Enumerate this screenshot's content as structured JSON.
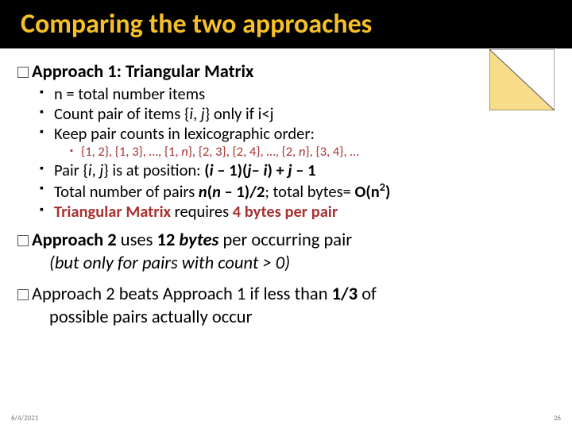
{
  "title": "Comparing the two approaches",
  "approach1": {
    "heading": "Approach 1: Triangular Matrix",
    "b1": "n = total number items",
    "b2_a": "Count pair of items {",
    "b2_b": "i",
    "b2_c": ", ",
    "b2_d": "j",
    "b2_e": "} only if i<j",
    "b3": "Keep pair counts in lexicographic order:",
    "b3sub_a": "{1, 2}, {1, 3}, …, {1, ",
    "b3sub_b": "n",
    "b3sub_c": "}, {2, 3}, {2, 4}, …, {2, ",
    "b3sub_d": "n",
    "b3sub_e": "}, {3, 4}, …",
    "b4_a": "Pair {",
    "b4_b": "i",
    "b4_c": ", ",
    "b4_d": "j",
    "b4_e": "} is at position: ",
    "b4_f": "(",
    "b4_g": "i",
    "b4_h": " – 1)(",
    "b4_i": "j",
    "b4_j": "– ",
    "b4_k": "i",
    "b4_l": ") + ",
    "b4_m": "j",
    "b4_n": " – 1",
    "b5_a": "Total number of pairs ",
    "b5_b": "n",
    "b5_c": "(",
    "b5_d": "n",
    "b5_e": " – 1)/2",
    "b5_f": "; total bytes= ",
    "b5_g": "O(n",
    "b5_h": "2",
    "b5_i": ")",
    "b6_a": "Triangular Matrix",
    "b6_b": " requires ",
    "b6_c": "4 bytes per pair"
  },
  "approach2": {
    "heading_a": "Approach 2",
    "heading_b": " uses ",
    "heading_c": "12 ",
    "heading_d": "bytes",
    "heading_e": " per occurring pair",
    "cont": "(but only for pairs with count > 0)"
  },
  "compare": {
    "heading_a": "Approach 2 beats Approach 1 if less than ",
    "heading_b": "1/3",
    "heading_c": " of",
    "cont": "possible pairs actually occur"
  },
  "footer": {
    "date": "6/4/2021",
    "page": "26"
  },
  "colors": {
    "title_bg": "#000000",
    "title_fg": "#f6c026",
    "accent_red": "#a93231",
    "triangle_fill": "#f9dc8a"
  }
}
